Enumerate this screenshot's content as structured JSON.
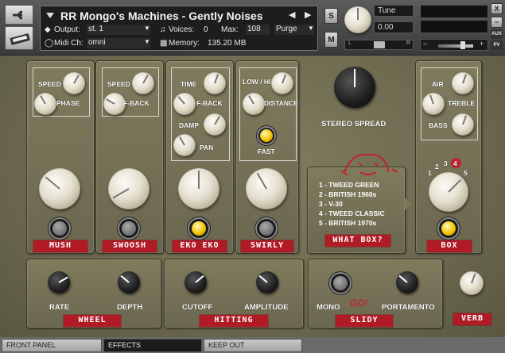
{
  "header": {
    "instrument_name": "RR Mongo's Machines - Gently Noises",
    "output_label": "Output:",
    "output_value": "st. 1",
    "voices_label": "Voices:",
    "voices_value": "0",
    "max_label": "Max:",
    "max_value": "108",
    "purge_label": "Purge",
    "midi_label": "Midi Ch:",
    "midi_value": "omni",
    "memory_label": "Memory:",
    "memory_value": "135.20 MB",
    "solo_label": "S",
    "mute_label": "M",
    "tune_label": "Tune",
    "tune_value": "0.00",
    "pan_left": "L",
    "pan_right": "R",
    "close_label": "X",
    "aux_label": "AUX",
    "pv_label": "PV",
    "minus_label": "−",
    "plus_label": "+"
  },
  "modules": {
    "mush": {
      "speed": "SPEED",
      "phase": "PHASE",
      "name": "MUSH"
    },
    "swoosh": {
      "speed": "SPEED",
      "fback": "F-BACK",
      "name": "SWOOSH"
    },
    "ekoeko": {
      "time": "TIME",
      "fback": "F-BACK",
      "damp": "DAMP",
      "pan": "PAN",
      "name": "EKO EKO"
    },
    "swirly": {
      "lowhi": "LOW / HI",
      "distance": "DISTANCE",
      "fast": "FAST",
      "name": "SWIRLY"
    },
    "stereo_spread": "STEREO SPREAD",
    "whatbox": {
      "name": "WHAT BOX?",
      "items": [
        "1 - TWEED GREEN",
        "2 - BRITISH 1960s",
        "3 - V-30",
        "4 - TWEED CLASSIC",
        "5 - BRITISH 1970s"
      ]
    },
    "box": {
      "air": "AIR",
      "treble": "TREBLE",
      "bass": "BASS",
      "name": "BOX",
      "numbers": [
        "1",
        "2",
        "3",
        "4",
        "5"
      ]
    },
    "wheel": {
      "rate": "RATE",
      "depth": "DEPTH",
      "name": "WHEEL"
    },
    "hitting": {
      "cutoff": "CUTOFF",
      "amplitude": "AMPLITUDE",
      "name": "HITTING"
    },
    "slidy": {
      "mono": "MONO",
      "portamento": "PORTAMENTO",
      "name": "SLIDY",
      "go": "GO!"
    },
    "verb": {
      "name": "VERB"
    }
  },
  "tabs": [
    {
      "label": "FRONT PANEL"
    },
    {
      "label": "EFFECTS"
    },
    {
      "label": "KEEP OUT"
    }
  ]
}
